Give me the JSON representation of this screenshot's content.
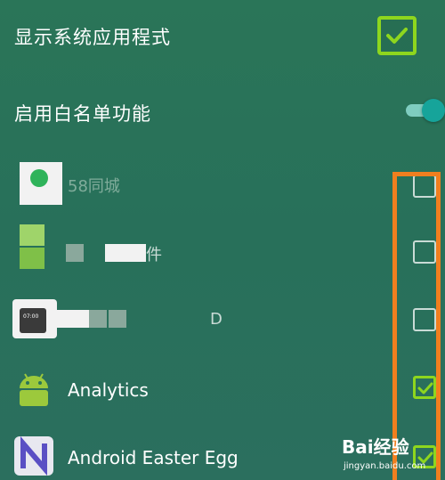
{
  "settings": {
    "show_system_apps_label": "显示系统应用程式",
    "enable_whitelist_label": "启用白名单功能",
    "show_system_apps_checked": true,
    "enable_whitelist_on": true
  },
  "apps": [
    {
      "name": "58同城",
      "checked": false
    },
    {
      "name": "件",
      "checked": false
    },
    {
      "name": "D",
      "checked": false
    },
    {
      "name": "Analytics",
      "checked": true
    },
    {
      "name": "Android Easter Egg",
      "checked": true
    }
  ],
  "watermark": {
    "title": "Bai经验",
    "url": "jingyan.baidu.com"
  },
  "colors": {
    "accent_green": "#8ed61e",
    "highlight_orange": "#f07f1f",
    "toggle_teal": "#16a49a"
  }
}
